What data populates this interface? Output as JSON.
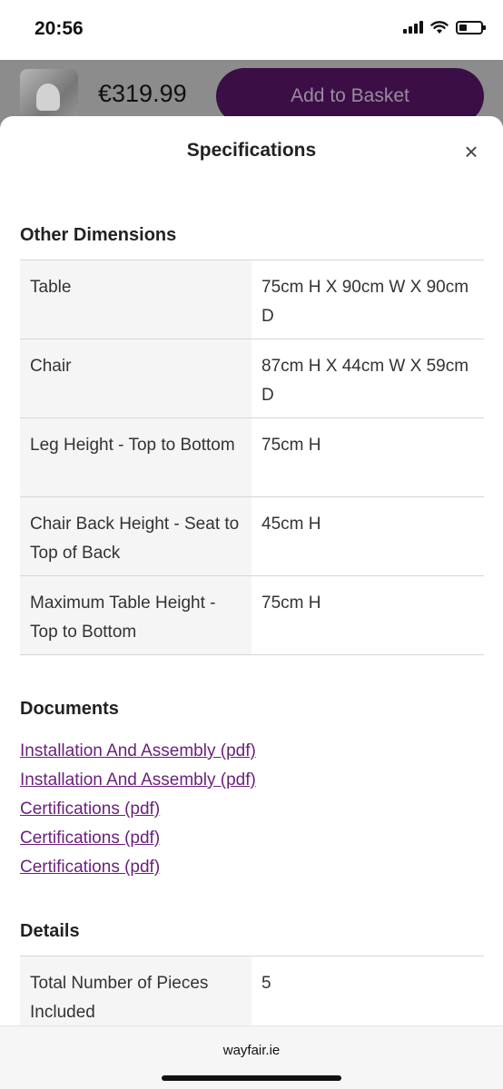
{
  "status_bar": {
    "time": "20:56"
  },
  "purchase_bar": {
    "price": "€319.99",
    "add_to_basket_label": "Add to Basket"
  },
  "sheet": {
    "title": "Specifications",
    "close_glyph": "×",
    "other_dimensions": {
      "heading": "Other Dimensions",
      "rows": [
        {
          "label": "Table",
          "value": "75cm H X 90cm W X 90cm D"
        },
        {
          "label": "Chair",
          "value": "87cm H X 44cm W X 59cm D"
        },
        {
          "label": "Leg Height - Top to Bottom",
          "value": "75cm H"
        },
        {
          "label": "Chair Back Height - Seat to Top of Back",
          "value": "45cm H"
        },
        {
          "label": "Maximum Table Height - Top to Bottom",
          "value": "75cm H"
        }
      ]
    },
    "documents": {
      "heading": "Documents",
      "links": [
        "Installation And Assembly (pdf)",
        "Installation And Assembly (pdf)",
        "Certifications (pdf)",
        "Certifications (pdf)",
        "Certifications (pdf)"
      ]
    },
    "details": {
      "heading": "Details",
      "rows": [
        {
          "label": "Total Number of Pieces Included",
          "value": "5"
        }
      ]
    }
  },
  "browser": {
    "url": "wayfair.ie"
  },
  "icons": {
    "signal": "cellular-signal-icon",
    "wifi": "wifi-icon",
    "battery": "battery-icon",
    "close": "close-icon"
  },
  "colors": {
    "accent": "#6a1f7a",
    "button_bg": "#3b0f45",
    "table_label_bg": "#f5f5f5",
    "overlay": "#8c8c8c"
  }
}
